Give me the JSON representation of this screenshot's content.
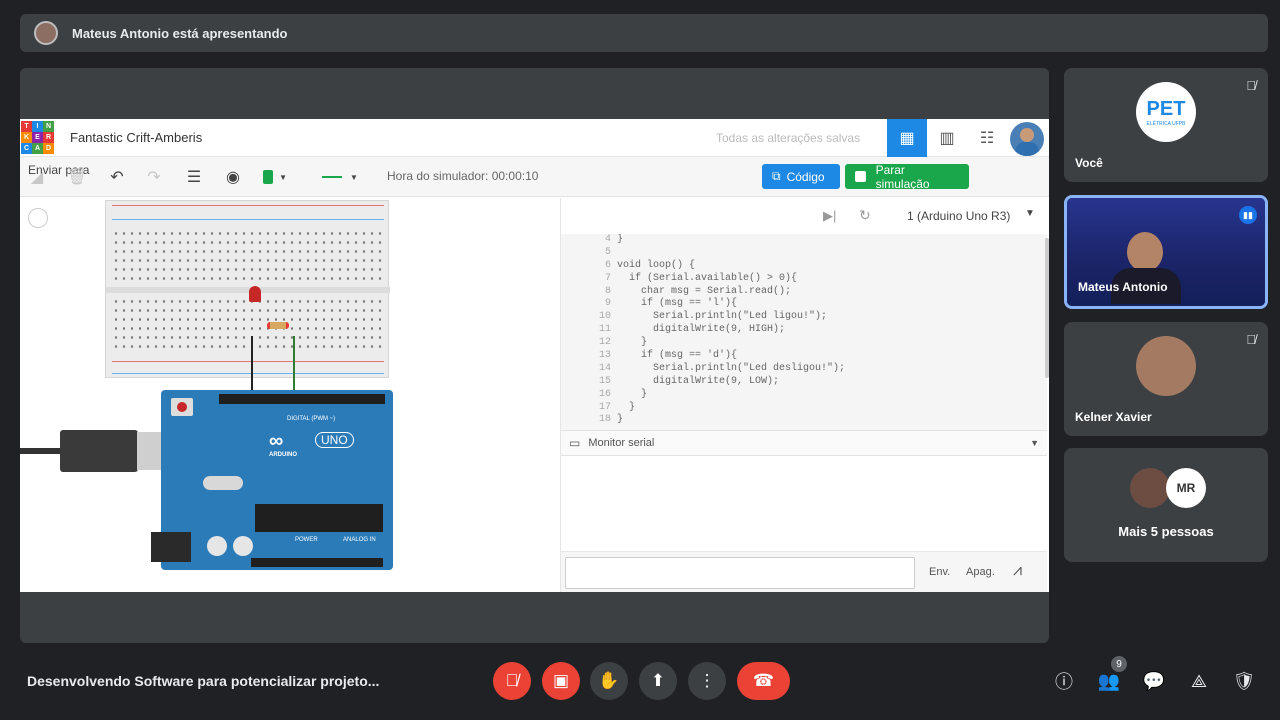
{
  "presenter": {
    "text": "Mateus Antonio está apresentando"
  },
  "tinkercad": {
    "logo_letters": [
      "TIN",
      "KER",
      "CAD"
    ],
    "project_name": "Fantastic Crift-Amberis",
    "saved_status": "Todas as alterações salvas",
    "sim_time": "Hora do simulador: 00:00:10",
    "code_button": "Código",
    "stop_button": "Parar simulação",
    "send_button": "Enviar para",
    "board_selector": "1 (Arduino Uno R3)",
    "code_lines": [
      {
        "n": "4",
        "t": "}"
      },
      {
        "n": "5",
        "t": ""
      },
      {
        "n": "6",
        "t": "void loop() {"
      },
      {
        "n": "7",
        "t": "  if (Serial.available() > 0){"
      },
      {
        "n": "8",
        "t": "    char msg = Serial.read();"
      },
      {
        "n": "9",
        "t": "    if (msg == 'l'){"
      },
      {
        "n": "10",
        "t": "      Serial.println(\"Led ligou!\");"
      },
      {
        "n": "11",
        "t": "      digitalWrite(9, HIGH);"
      },
      {
        "n": "12",
        "t": "    }"
      },
      {
        "n": "13",
        "t": "    if (msg == 'd'){"
      },
      {
        "n": "14",
        "t": "      Serial.println(\"Led desligou!\");"
      },
      {
        "n": "15",
        "t": "      digitalWrite(9, LOW);"
      },
      {
        "n": "16",
        "t": "    }"
      },
      {
        "n": "17",
        "t": "  }"
      },
      {
        "n": "18",
        "t": "}"
      }
    ],
    "serial_monitor": "Monitor serial",
    "send_serial": "Env.",
    "clear_serial": "Apag.",
    "arduino_label": "ARDUINO",
    "uno_label": "UNO",
    "digital_label": "DIGITAL (PWM ~)",
    "power_label": "POWER",
    "analog_label": "ANALOG IN"
  },
  "participants": [
    {
      "name": "Você",
      "logo": "PET",
      "logo_sub": "ELÉTRICA UFPB"
    },
    {
      "name": "Mateus Antonio"
    },
    {
      "name": "Kelner Xavier"
    },
    {
      "name": "Mais 5 pessoas",
      "avatar_text": "MR"
    }
  ],
  "meeting": {
    "title": "Desenvolvendo Software para potencializar projeto...",
    "people_count": "9"
  },
  "colors": {
    "accent_blue": "#1e88e5",
    "green": "#1aa64a",
    "end_call_red": "#ea4335"
  }
}
